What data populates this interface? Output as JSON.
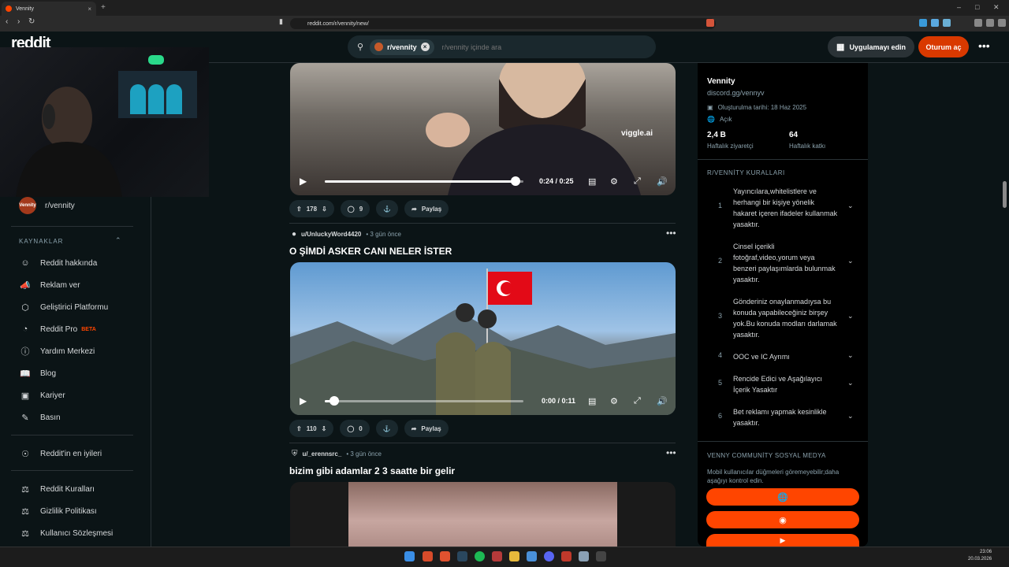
{
  "browser": {
    "tab_title": "Vennity",
    "tab_close": "×",
    "new_tab": "+",
    "url": "reddit.com/r/vennity/new/",
    "min": "–",
    "max": "□",
    "close": "✕"
  },
  "header": {
    "logo": "reddit",
    "search_chip": "r/vennity",
    "search_placeholder": "r/vennity içinde ara",
    "get_app": "Uygulamayı edin",
    "login": "Oturum aç",
    "more": "•••"
  },
  "sidebar": {
    "subreddit": "r/vennity",
    "avatar_text": "Vennity",
    "resources_title": "KAYNAKLAR",
    "resources": [
      {
        "label": "Reddit hakkında",
        "icon": "reddit-icon"
      },
      {
        "label": "Reklam ver",
        "icon": "megaphone-icon"
      },
      {
        "label": "Geliştirici Platformu",
        "icon": "dev-platform-icon"
      },
      {
        "label": "Reddit Pro",
        "icon": "reddit-pro-icon",
        "badge": "BETA"
      },
      {
        "label": "Yardım Merkezi",
        "icon": "help-icon"
      },
      {
        "label": "Blog",
        "icon": "book-icon"
      },
      {
        "label": "Kariyer",
        "icon": "briefcase-icon"
      },
      {
        "label": "Basın",
        "icon": "press-icon"
      }
    ],
    "best_of": "Reddit'in en iyileri",
    "policies": [
      {
        "label": "Reddit Kuralları"
      },
      {
        "label": "Gizlilik Politikası"
      },
      {
        "label": "Kullanıcı Sözleşmesi"
      }
    ]
  },
  "posts": [
    {
      "video": {
        "time": "0:24 / 0:25",
        "progress": 0.96
      },
      "votes": "178",
      "comments": "9",
      "share": "Paylaş"
    },
    {
      "author": "u/UnluckyWord4420",
      "ago": "3 gün önce",
      "title": "O ŞİMDİ ASKER CANI NELER İSTER",
      "video": {
        "time": "0:00 / 0:11",
        "progress": 0.0
      },
      "votes": "110",
      "comments": "0",
      "share": "Paylaş"
    },
    {
      "author": "u/_erennsrc_",
      "ago": "3 gün önce",
      "title": "bizim gibi adamlar 2 3 saatte bir gelir"
    }
  ],
  "watermark": "viggle.ai",
  "community": {
    "name": "Vennity",
    "link": "discord.gg/vennyv",
    "created": "Oluşturulma tarihi: 18 Haz 2025",
    "visibility": "Açık",
    "weekly_visitors_value": "2,4 B",
    "weekly_visitors_label": "Haftalık ziyaretçi",
    "weekly_contrib_value": "64",
    "weekly_contrib_label": "Haftalık katkı",
    "rules_title": "R/VENNİTY KURALLARI",
    "rules": [
      {
        "num": "1",
        "text": "Yayıncılara,whitelistlere ve herhangi bir kişiye yönelik hakaret içeren ifadeler kullanmak yasaktır."
      },
      {
        "num": "2",
        "text": "Cinsel içerikli fotoğraf,video,yorum veya benzeri paylaşımlarda bulunmak yasaktır."
      },
      {
        "num": "3",
        "text": "Gönderiniz onaylanmadıysa bu konuda yapabileceğiniz birşey yok.Bu konuda modları darlamak yasaktır."
      },
      {
        "num": "4",
        "text": "OOC ve IC Ayrımı"
      },
      {
        "num": "5",
        "text": "Rencide Edici ve Aşağılayıcı İçerik Yasaktır"
      },
      {
        "num": "6",
        "text": "Bet reklamı yapmak kesinlikle yasaktır."
      }
    ],
    "social_title": "VENNY COMMUNİTY SOSYAL MEDYA",
    "social_desc": "Mobil kullanıcılar düğmeleri göremeyebilir;daha aşağıyı kontrol edin."
  },
  "taskbar": {
    "time": "23:06",
    "date": "20.03.2026"
  },
  "colors": {
    "accent": "#ff4500",
    "login": "#d93900",
    "bg": "#0b1416"
  }
}
